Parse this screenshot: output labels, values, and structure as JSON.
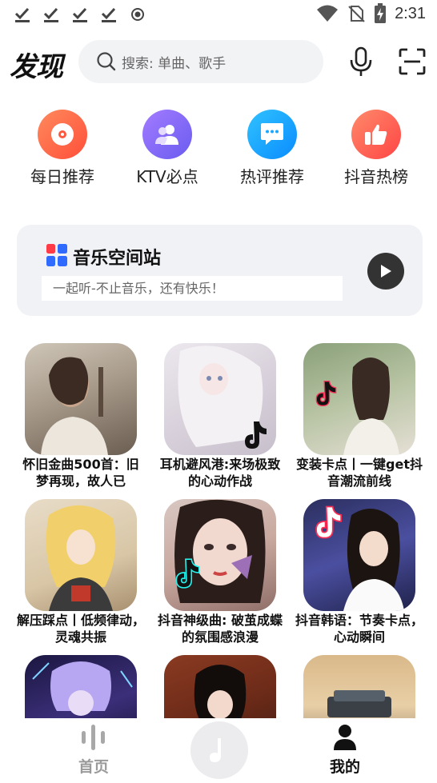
{
  "status_bar": {
    "time": "2:31",
    "left_icons": [
      "download-done-icon",
      "download-done-icon",
      "download-done-icon",
      "download-done-icon",
      "record-icon"
    ],
    "right_icons": [
      "wifi-icon",
      "no-sim-icon",
      "battery-charging-icon"
    ]
  },
  "header": {
    "title": "发现",
    "search_placeholder": "搜索: 单曲、歌手"
  },
  "quick_actions": [
    {
      "label": "每日推荐",
      "icon": "vinyl-icon",
      "color": "#ff6b4a"
    },
    {
      "label": "KTV必点",
      "icon": "group-icon",
      "color": "#8a6cf5"
    },
    {
      "label": "热评推荐",
      "icon": "comment-icon",
      "color": "#1aa7ff"
    },
    {
      "label": "抖音热榜",
      "icon": "thumbs-up-icon",
      "color": "#ff5a4e"
    }
  ],
  "station": {
    "title": "音乐空间站",
    "subtitle": "一起听-不止音乐，还有快乐！"
  },
  "playlists": [
    {
      "title": "怀旧金曲500首：旧梦再现，故人已"
    },
    {
      "title": "耳机避风港:来场极致的心动作战"
    },
    {
      "title": "变装卡点丨一键get抖音潮流前线"
    },
    {
      "title": "解压踩点丨低频律动，灵魂共振"
    },
    {
      "title": "抖音神级曲: 破茧成蝶的氛围感浪漫"
    },
    {
      "title": "抖音韩语：节奏卡点，心动瞬间"
    },
    {
      "title": ""
    },
    {
      "title": ""
    },
    {
      "title": ""
    }
  ],
  "bottom_nav": {
    "home_label": "首页",
    "mine_label": "我的",
    "active": "我的"
  },
  "colors": {
    "accent_text": "#111111",
    "inactive_nav": "#9a9a9a",
    "station_bg": "#f1f2f6"
  }
}
